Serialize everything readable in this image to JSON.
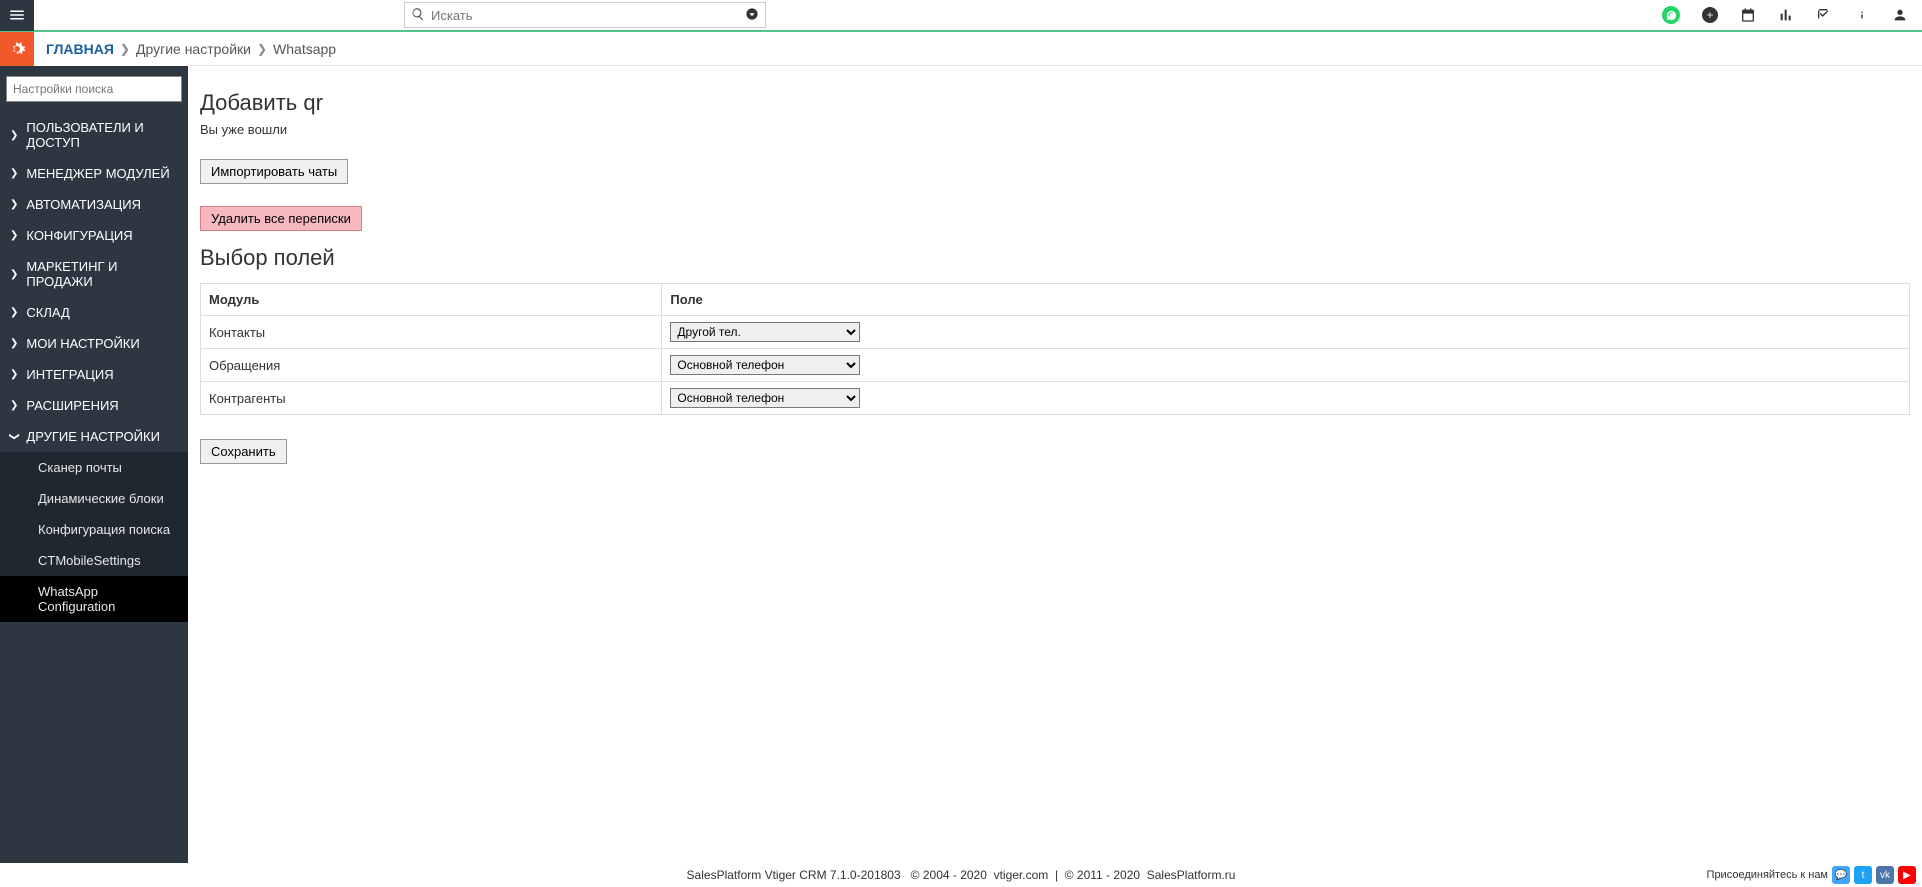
{
  "topbar": {
    "search_placeholder": "Искать"
  },
  "breadcrumb": {
    "home": "ГЛАВНАЯ",
    "other": "Другие настройки",
    "current": "Whatsapp"
  },
  "sidebar": {
    "search_placeholder": "Настройки поиска",
    "groups": [
      {
        "label": "ПОЛЬЗОВАТЕЛИ И ДОСТУП"
      },
      {
        "label": "МЕНЕДЖЕР МОДУЛЕЙ"
      },
      {
        "label": "АВТОМАТИЗАЦИЯ"
      },
      {
        "label": "КОНФИГУРАЦИЯ"
      },
      {
        "label": "МАРКЕТИНГ И ПРОДАЖИ"
      },
      {
        "label": "СКЛАД"
      },
      {
        "label": "МОИ НАСТРОЙКИ"
      },
      {
        "label": "ИНТЕГРАЦИЯ"
      },
      {
        "label": "РАСШИРЕНИЯ"
      },
      {
        "label": "ДРУГИЕ НАСТРОЙКИ"
      }
    ],
    "sub": [
      {
        "label": "Сканер почты"
      },
      {
        "label": "Динамические блоки"
      },
      {
        "label": "Конфигурация поиска"
      },
      {
        "label": "CTMobileSettings"
      },
      {
        "label": "WhatsApp Configuration"
      }
    ]
  },
  "page": {
    "title": "Добавить qr",
    "logged_in": "Вы уже вошли",
    "import_btn": "Импортировать чаты",
    "delete_btn": "Удалить все переписки",
    "fields_header": "Выбор полей",
    "th_module": "Модуль",
    "th_field": "Поле",
    "rows": [
      {
        "module": "Контакты",
        "field": "Другой тел."
      },
      {
        "module": "Обращения",
        "field": "Основной телефон"
      },
      {
        "module": "Контрагенты",
        "field": "Основной телефон"
      }
    ],
    "save_btn": "Сохранить"
  },
  "footer": {
    "left": "SalesPlatform Vtiger CRM 7.1.0-201803",
    "c1": "© 2004 - 2020",
    "v": "vtiger.com",
    "sep": "|",
    "c2": "© 2011 - 2020",
    "sp": "SalesPlatform.ru",
    "join": "Присоединяйтесь к нам"
  }
}
